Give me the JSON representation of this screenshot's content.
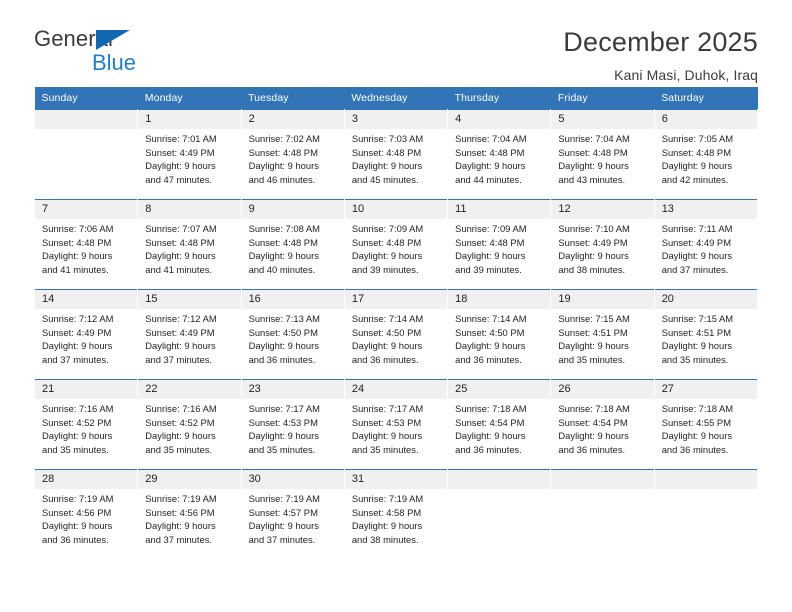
{
  "brand": {
    "name_part1": "General",
    "name_part2": "Blue"
  },
  "header": {
    "title": "December 2025",
    "subtitle": "Kani Masi, Duhok, Iraq"
  },
  "colors": {
    "header_blue": "#3174b8",
    "logo_blue": "#1b7fd4",
    "daynum_bg": "#f0f0f0",
    "text": "#231f20"
  },
  "weekdays": [
    "Sunday",
    "Monday",
    "Tuesday",
    "Wednesday",
    "Thursday",
    "Friday",
    "Saturday"
  ],
  "weeks": [
    [
      {
        "day": "",
        "l1": "",
        "l2": "",
        "l3": "",
        "l4": ""
      },
      {
        "day": "1",
        "l1": "Sunrise: 7:01 AM",
        "l2": "Sunset: 4:49 PM",
        "l3": "Daylight: 9 hours",
        "l4": "and 47 minutes."
      },
      {
        "day": "2",
        "l1": "Sunrise: 7:02 AM",
        "l2": "Sunset: 4:48 PM",
        "l3": "Daylight: 9 hours",
        "l4": "and 46 minutes."
      },
      {
        "day": "3",
        "l1": "Sunrise: 7:03 AM",
        "l2": "Sunset: 4:48 PM",
        "l3": "Daylight: 9 hours",
        "l4": "and 45 minutes."
      },
      {
        "day": "4",
        "l1": "Sunrise: 7:04 AM",
        "l2": "Sunset: 4:48 PM",
        "l3": "Daylight: 9 hours",
        "l4": "and 44 minutes."
      },
      {
        "day": "5",
        "l1": "Sunrise: 7:04 AM",
        "l2": "Sunset: 4:48 PM",
        "l3": "Daylight: 9 hours",
        "l4": "and 43 minutes."
      },
      {
        "day": "6",
        "l1": "Sunrise: 7:05 AM",
        "l2": "Sunset: 4:48 PM",
        "l3": "Daylight: 9 hours",
        "l4": "and 42 minutes."
      }
    ],
    [
      {
        "day": "7",
        "l1": "Sunrise: 7:06 AM",
        "l2": "Sunset: 4:48 PM",
        "l3": "Daylight: 9 hours",
        "l4": "and 41 minutes."
      },
      {
        "day": "8",
        "l1": "Sunrise: 7:07 AM",
        "l2": "Sunset: 4:48 PM",
        "l3": "Daylight: 9 hours",
        "l4": "and 41 minutes."
      },
      {
        "day": "9",
        "l1": "Sunrise: 7:08 AM",
        "l2": "Sunset: 4:48 PM",
        "l3": "Daylight: 9 hours",
        "l4": "and 40 minutes."
      },
      {
        "day": "10",
        "l1": "Sunrise: 7:09 AM",
        "l2": "Sunset: 4:48 PM",
        "l3": "Daylight: 9 hours",
        "l4": "and 39 minutes."
      },
      {
        "day": "11",
        "l1": "Sunrise: 7:09 AM",
        "l2": "Sunset: 4:48 PM",
        "l3": "Daylight: 9 hours",
        "l4": "and 39 minutes."
      },
      {
        "day": "12",
        "l1": "Sunrise: 7:10 AM",
        "l2": "Sunset: 4:49 PM",
        "l3": "Daylight: 9 hours",
        "l4": "and 38 minutes."
      },
      {
        "day": "13",
        "l1": "Sunrise: 7:11 AM",
        "l2": "Sunset: 4:49 PM",
        "l3": "Daylight: 9 hours",
        "l4": "and 37 minutes."
      }
    ],
    [
      {
        "day": "14",
        "l1": "Sunrise: 7:12 AM",
        "l2": "Sunset: 4:49 PM",
        "l3": "Daylight: 9 hours",
        "l4": "and 37 minutes."
      },
      {
        "day": "15",
        "l1": "Sunrise: 7:12 AM",
        "l2": "Sunset: 4:49 PM",
        "l3": "Daylight: 9 hours",
        "l4": "and 37 minutes."
      },
      {
        "day": "16",
        "l1": "Sunrise: 7:13 AM",
        "l2": "Sunset: 4:50 PM",
        "l3": "Daylight: 9 hours",
        "l4": "and 36 minutes."
      },
      {
        "day": "17",
        "l1": "Sunrise: 7:14 AM",
        "l2": "Sunset: 4:50 PM",
        "l3": "Daylight: 9 hours",
        "l4": "and 36 minutes."
      },
      {
        "day": "18",
        "l1": "Sunrise: 7:14 AM",
        "l2": "Sunset: 4:50 PM",
        "l3": "Daylight: 9 hours",
        "l4": "and 36 minutes."
      },
      {
        "day": "19",
        "l1": "Sunrise: 7:15 AM",
        "l2": "Sunset: 4:51 PM",
        "l3": "Daylight: 9 hours",
        "l4": "and 35 minutes."
      },
      {
        "day": "20",
        "l1": "Sunrise: 7:15 AM",
        "l2": "Sunset: 4:51 PM",
        "l3": "Daylight: 9 hours",
        "l4": "and 35 minutes."
      }
    ],
    [
      {
        "day": "21",
        "l1": "Sunrise: 7:16 AM",
        "l2": "Sunset: 4:52 PM",
        "l3": "Daylight: 9 hours",
        "l4": "and 35 minutes."
      },
      {
        "day": "22",
        "l1": "Sunrise: 7:16 AM",
        "l2": "Sunset: 4:52 PM",
        "l3": "Daylight: 9 hours",
        "l4": "and 35 minutes."
      },
      {
        "day": "23",
        "l1": "Sunrise: 7:17 AM",
        "l2": "Sunset: 4:53 PM",
        "l3": "Daylight: 9 hours",
        "l4": "and 35 minutes."
      },
      {
        "day": "24",
        "l1": "Sunrise: 7:17 AM",
        "l2": "Sunset: 4:53 PM",
        "l3": "Daylight: 9 hours",
        "l4": "and 35 minutes."
      },
      {
        "day": "25",
        "l1": "Sunrise: 7:18 AM",
        "l2": "Sunset: 4:54 PM",
        "l3": "Daylight: 9 hours",
        "l4": "and 36 minutes."
      },
      {
        "day": "26",
        "l1": "Sunrise: 7:18 AM",
        "l2": "Sunset: 4:54 PM",
        "l3": "Daylight: 9 hours",
        "l4": "and 36 minutes."
      },
      {
        "day": "27",
        "l1": "Sunrise: 7:18 AM",
        "l2": "Sunset: 4:55 PM",
        "l3": "Daylight: 9 hours",
        "l4": "and 36 minutes."
      }
    ],
    [
      {
        "day": "28",
        "l1": "Sunrise: 7:19 AM",
        "l2": "Sunset: 4:56 PM",
        "l3": "Daylight: 9 hours",
        "l4": "and 36 minutes."
      },
      {
        "day": "29",
        "l1": "Sunrise: 7:19 AM",
        "l2": "Sunset: 4:56 PM",
        "l3": "Daylight: 9 hours",
        "l4": "and 37 minutes."
      },
      {
        "day": "30",
        "l1": "Sunrise: 7:19 AM",
        "l2": "Sunset: 4:57 PM",
        "l3": "Daylight: 9 hours",
        "l4": "and 37 minutes."
      },
      {
        "day": "31",
        "l1": "Sunrise: 7:19 AM",
        "l2": "Sunset: 4:58 PM",
        "l3": "Daylight: 9 hours",
        "l4": "and 38 minutes."
      },
      {
        "day": "",
        "l1": "",
        "l2": "",
        "l3": "",
        "l4": ""
      },
      {
        "day": "",
        "l1": "",
        "l2": "",
        "l3": "",
        "l4": ""
      },
      {
        "day": "",
        "l1": "",
        "l2": "",
        "l3": "",
        "l4": ""
      }
    ]
  ]
}
